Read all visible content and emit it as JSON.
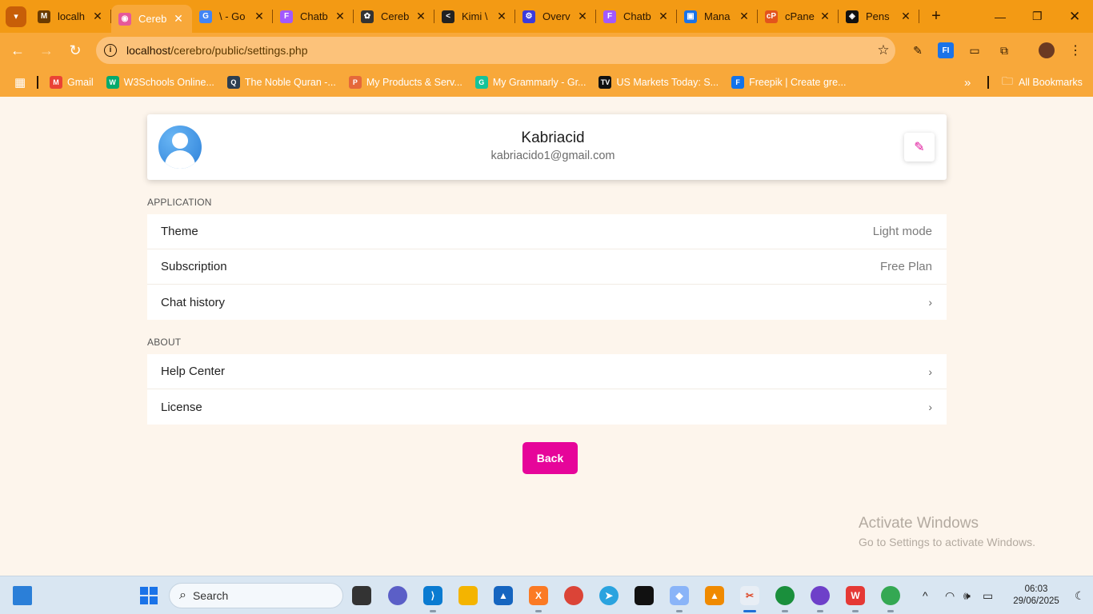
{
  "browser": {
    "tabs": [
      {
        "label": "localh",
        "fav_color": "#6b3b00",
        "fav_glyph": "M"
      },
      {
        "label": "Cereb",
        "fav_color": "#e6589a",
        "fav_glyph": "◉",
        "active": true
      },
      {
        "label": "\\ - Go",
        "fav_color": "#4285f4",
        "fav_glyph": "G"
      },
      {
        "label": "Chatb",
        "fav_color": "#a259ff",
        "fav_glyph": "F"
      },
      {
        "label": "Cereb",
        "fav_color": "#333333",
        "fav_glyph": "✿"
      },
      {
        "label": "Kimi \\",
        "fav_color": "#222222",
        "fav_glyph": "<"
      },
      {
        "label": "Overv",
        "fav_color": "#3b3bdc",
        "fav_glyph": "⚙"
      },
      {
        "label": "Chatb",
        "fav_color": "#a259ff",
        "fav_glyph": "F"
      },
      {
        "label": "Mana",
        "fav_color": "#1a73e8",
        "fav_glyph": "▣"
      },
      {
        "label": "cPane",
        "fav_color": "#e3541c",
        "fav_glyph": "cP"
      },
      {
        "label": "Pens",
        "fav_color": "#111111",
        "fav_glyph": "◈"
      }
    ],
    "address": {
      "host": "localhost",
      "path": "/cerebro/public/settings.php"
    },
    "bookmarks": [
      {
        "label": "Gmail",
        "fav_color": "#ea4335",
        "fav_glyph": "M"
      },
      {
        "label": "W3Schools Online...",
        "fav_color": "#04aa6d",
        "fav_glyph": "W"
      },
      {
        "label": "The Noble Quran -...",
        "fav_color": "#2d3e50",
        "fav_glyph": "Q"
      },
      {
        "label": "My Products & Serv...",
        "fav_color": "#e5683a",
        "fav_glyph": "P"
      },
      {
        "label": "My Grammarly - Gr...",
        "fav_color": "#15c39a",
        "fav_glyph": "G"
      },
      {
        "label": "US Markets Today: S...",
        "fav_color": "#111111",
        "fav_glyph": "TV"
      },
      {
        "label": "Freepik | Create gre...",
        "fav_color": "#1273eb",
        "fav_glyph": "F"
      }
    ],
    "all_bookmarks_label": "All Bookmarks"
  },
  "profile": {
    "name": "Kabriacid",
    "email": "kabriacido1@gmail.com",
    "edit_icon": "pencil-icon"
  },
  "sections": {
    "application": {
      "label": "APPLICATION",
      "items": [
        {
          "label": "Theme",
          "value": "Light mode"
        },
        {
          "label": "Subscription",
          "value": "Free Plan"
        },
        {
          "label": "Chat history",
          "value": "›"
        }
      ]
    },
    "about": {
      "label": "ABOUT",
      "items": [
        {
          "label": "Help Center",
          "value": "›"
        },
        {
          "label": "License",
          "value": "›"
        }
      ]
    }
  },
  "back_label": "Back",
  "watermark": {
    "title": "Activate Windows",
    "subtitle": "Go to Settings to activate Windows."
  },
  "taskbar": {
    "search_placeholder": "Search",
    "time": "06:03",
    "date": "29/06/2025"
  },
  "colors": {
    "browser_theme": "#f8a83a",
    "page_bg": "#fdf5ec",
    "accent": "#e6059a"
  }
}
